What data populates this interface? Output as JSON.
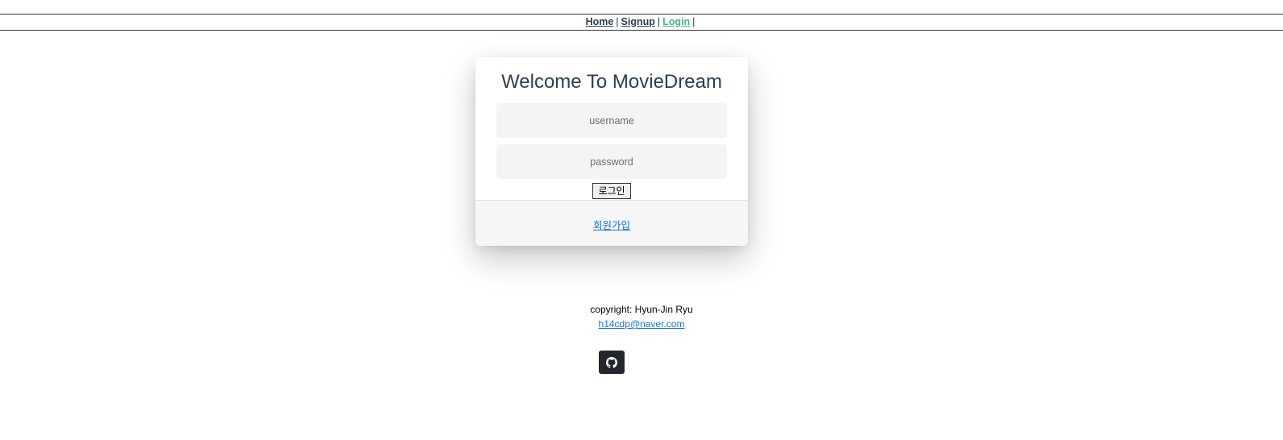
{
  "nav": {
    "items": [
      {
        "label": "Home"
      },
      {
        "label": "Signup"
      },
      {
        "label": "Login"
      }
    ],
    "separator": "|"
  },
  "login_card": {
    "title": "Welcome To MovieDream",
    "username_placeholder": "username",
    "password_placeholder": "password",
    "login_button": "로그인",
    "signup_link": "회원가입"
  },
  "footer": {
    "copyright": "copyright: Hyun-Jin Ryu",
    "email": "h14cdp@naver.com",
    "github_icon": "github-icon"
  },
  "colors": {
    "text": "#2c3e50",
    "active_link": "#42b983",
    "link": "#1a73e8",
    "github_button": "#23262b"
  }
}
